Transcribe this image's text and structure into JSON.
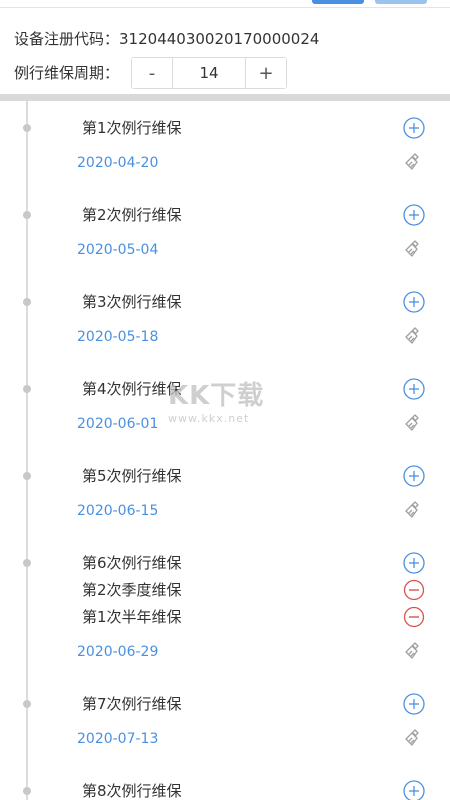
{
  "header": {
    "device_code_label": "设备注册代码：",
    "device_code_value": "312044030020170000024",
    "cycle_label": "例行维保周期：",
    "stepper": {
      "minus": "-",
      "value": "14",
      "plus": "+"
    }
  },
  "groups": [
    {
      "tasks": [
        {
          "label": "第1次例行维保",
          "action": "add"
        }
      ],
      "date": "2020-04-20"
    },
    {
      "tasks": [
        {
          "label": "第2次例行维保",
          "action": "add"
        }
      ],
      "date": "2020-05-04"
    },
    {
      "tasks": [
        {
          "label": "第3次例行维保",
          "action": "add"
        }
      ],
      "date": "2020-05-18"
    },
    {
      "tasks": [
        {
          "label": "第4次例行维保",
          "action": "add"
        }
      ],
      "date": "2020-06-01"
    },
    {
      "tasks": [
        {
          "label": "第5次例行维保",
          "action": "add"
        }
      ],
      "date": "2020-06-15"
    },
    {
      "tasks": [
        {
          "label": "第6次例行维保",
          "action": "add"
        },
        {
          "label": "第2次季度维保",
          "action": "remove"
        },
        {
          "label": "第1次半年维保",
          "action": "remove"
        }
      ],
      "date": "2020-06-29"
    },
    {
      "tasks": [
        {
          "label": "第7次例行维保",
          "action": "add"
        }
      ],
      "date": "2020-07-13"
    },
    {
      "tasks": [
        {
          "label": "第8次例行维保",
          "action": "add"
        }
      ],
      "date": ""
    }
  ],
  "icons": {
    "add": "plus-circle-icon",
    "remove": "minus-circle-icon",
    "clear": "brush-icon"
  },
  "colors": {
    "accent_blue": "#4a90e2",
    "remove_red": "#d9534f",
    "brush_gray": "#a0a0a0"
  },
  "watermark": {
    "main": "KK下载",
    "sub": "www.kkx.net"
  }
}
